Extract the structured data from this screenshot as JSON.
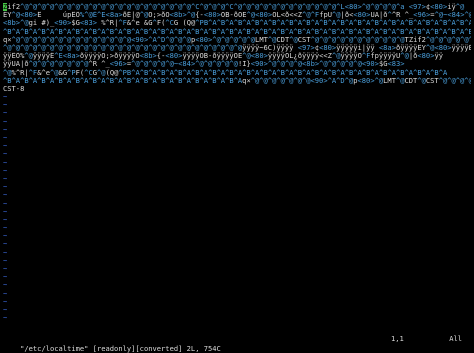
{
  "theme": {
    "background": "#000000",
    "text": "#d8d8d8",
    "control_char": "#4a9eda",
    "tilde": "#3a66d6",
    "cursor": "#46c646"
  },
  "buffer": {
    "lines": [
      [
        {
          "t": "Z",
          "c": "cursor"
        },
        {
          "t": "if2"
        },
        {
          "t": "^@^@^@^@^@^@^@^@^@^@^@^@^@^@^@^@^@^@^@^@^C^@^@^@^C^@^@^@^@^@^@^@^@^@^@^@^@^L<80>^@^@^@^@^a ",
          "c": "ctl"
        },
        {
          "t": "<97>",
          "c": "ctl"
        },
        {
          "t": "¢"
        },
        {
          "t": "<80>",
          "c": "ctl"
        },
        {
          "t": "iÿ"
        },
        {
          "t": "^@",
          "c": "ctl"
        }
      ],
      [
        {
          "t": "ÊY"
        },
        {
          "t": "^@",
          "c": "ctl"
        },
        {
          "t": "<80>",
          "c": "ctl"
        },
        {
          "t": "Ê     úpÊÖ"
        },
        {
          "t": "%",
          "c": "ctl"
        },
        {
          "t": "^@",
          "c": "ctl"
        },
        {
          "t": "Ê^E",
          "c": "ctl"
        },
        {
          "t": "<8a>",
          "c": "ctl"
        },
        {
          "t": "ðÊ|@"
        },
        {
          "t": "^@",
          "c": "ctl"
        },
        {
          "t": "O;>ðO"
        },
        {
          "t": "<8b>",
          "c": "ctl"
        },
        {
          "t": "^@",
          "c": "ctl"
        },
        {
          "t": "{-"
        },
        {
          "t": "<80>",
          "c": "ctl"
        },
        {
          "t": "ÕB-ðOE"
        },
        {
          "t": "^@",
          "c": "ctl"
        },
        {
          "t": "<80>",
          "c": "ctl"
        },
        {
          "t": "ÕL<ð<<Z"
        },
        {
          "t": "^@",
          "c": "ctl"
        },
        {
          "t": "^F",
          "c": "ctl"
        },
        {
          "t": "fpU"
        },
        {
          "t": "^@",
          "c": "ctl"
        },
        {
          "t": "|ð<"
        },
        {
          "t": "<80>",
          "c": "ctl"
        },
        {
          "t": "UA|ð"
        },
        {
          "t": "^",
          "c": "ctl"
        },
        {
          "t": "^R ^_"
        },
        {
          "t": "<96>",
          "c": "ctl"
        },
        {
          "t": "="
        },
        {
          "t": "^@",
          "c": "ctl"
        },
        {
          "t": "~<84>",
          "c": "ctl"
        },
        {
          "t": "^@",
          "c": "ctl"
        },
        {
          "t": "!I}"
        }
      ],
      [
        {
          "t": "<8b>",
          "c": "ctl"
        },
        {
          "t": "^@",
          "c": "ctl"
        },
        {
          "t": "gi #)_"
        },
        {
          "t": "<90>",
          "c": "ctl"
        },
        {
          "t": "$G"
        },
        {
          "t": "<83>",
          "c": "ctl"
        },
        {
          "t": " %^R|"
        },
        {
          "t": "^F",
          "c": "ctl"
        },
        {
          "t": "&^e &G"
        },
        {
          "t": "^",
          "c": "ctl"
        },
        {
          "t": "F("
        },
        {
          "t": "^C",
          "c": "ctl"
        },
        {
          "t": "G (Q@"
        },
        {
          "t": "^P",
          "c": "ctl"
        },
        {
          "t": "B^A^B^A^B^A^B^A^B^A^B^A^B^A^B^A^B^A^B^A^B^A^B^A^B^A^B^A^B^A^B^A",
          "c": "ctl"
        }
      ],
      [
        {
          "t": "^B^A^B^A^B^A^B^A^B^A^B^A^B^A^B^A^B^A^B^A^B^A^B^A^B^A^B^A^B^A^B^A^B^A^B^A^B^A^B^A^B^A^B^A^B^A^B^A^B^A^B^A^B^A^B^A^B^A^B^A",
          "c": "ctl"
        }
      ],
      [
        {
          "t": "q×"
        },
        {
          "t": "^@",
          "c": "ctl"
        },
        {
          "t": "^@^@^@^@^@^@^@^@^@^@^@^@^@",
          "c": "ctl"
        },
        {
          "t": "<90>",
          "c": "ctl"
        },
        {
          "t": "^A^D^@^@^@",
          "c": "ctl"
        },
        {
          "t": "p"
        },
        {
          "t": "<80>",
          "c": "ctl"
        },
        {
          "t": "^@^@^@^@^@",
          "c": "ctl"
        },
        {
          "t": "LMT"
        },
        {
          "t": "^@",
          "c": "ctl"
        },
        {
          "t": "CDT"
        },
        {
          "t": "^@",
          "c": "ctl"
        },
        {
          "t": "CST"
        },
        {
          "t": "^@^@^@^@^@^@^@^@^@^@^@",
          "c": "ctl"
        },
        {
          "t": "TZif2"
        },
        {
          "t": "^@^@^@^@^@^@^@^@^@^@^@^@^@^@^@^@^@^@^@^@^@^@^@^@",
          "c": "ctl"
        }
      ],
      [
        {
          "t": "^@^@^@^@^@^@^@^@^@^@^@^@^@^@^@^@^@^@^@^@^@^@^@^@^@^@^@^@",
          "c": "ctl"
        },
        {
          "t": "ÿÿÿÿ~6C)ÿÿÿÿ "
        },
        {
          "t": "<97>",
          "c": "ctl"
        },
        {
          "t": "¢"
        },
        {
          "t": "<80>",
          "c": "ctl"
        },
        {
          "t": "ÿÿÿÿÿi|ÿÿ "
        },
        {
          "t": "<8a>",
          "c": "ctl"
        },
        {
          "t": "ðÿÿÿÿÊY"
        },
        {
          "t": "^@",
          "c": "ctl"
        },
        {
          "t": "<80>",
          "c": "ctl"
        },
        {
          "t": "ÿÿÿÿÊ      upyy"
        }
      ],
      [
        {
          "t": "ÿÿÊÖ%"
        },
        {
          "t": "^@",
          "c": "ctl"
        },
        {
          "t": "ÿÿÿÿÊ"
        },
        {
          "t": "^E",
          "c": "ctl"
        },
        {
          "t": "<8a>",
          "c": "ctl"
        },
        {
          "t": "ðÿÿÿÿÕ;>ðÿÿÿÿÕ"
        },
        {
          "t": "<8b>",
          "c": "ctl"
        },
        {
          "t": "{-"
        },
        {
          "t": "<80>",
          "c": "ctl"
        },
        {
          "t": "ÿÿÿÿÕB-ðÿÿÿÿÕE"
        },
        {
          "t": "^@",
          "c": "ctl"
        },
        {
          "t": "<80>",
          "c": "ctl"
        },
        {
          "t": "ÿÿÿÿÕL¿ðÿÿÿÿ<<Z"
        },
        {
          "t": "^@",
          "c": "ctl"
        },
        {
          "t": "ÿÿÿÿÕ"
        },
        {
          "t": "^F",
          "c": "ctl"
        },
        {
          "t": "fpÿÿÿÿU"
        },
        {
          "t": "^@",
          "c": "ctl"
        },
        {
          "t": "|ð"
        },
        {
          "t": "<80>",
          "c": "ctl"
        },
        {
          "t": "ÿÿ"
        }
      ],
      [
        {
          "t": "ÿÿUA|ð"
        },
        {
          "t": "^@",
          "c": "ctl"
        },
        {
          "t": "^@^@^@^@^@^@",
          "c": "ctl"
        },
        {
          "t": "^R ^_"
        },
        {
          "t": "<96>",
          "c": "ctl"
        },
        {
          "t": "="
        },
        {
          "t": "^@",
          "c": "ctl"
        },
        {
          "t": "^@^@^@^@",
          "c": "ctl"
        },
        {
          "t": "~<84>",
          "c": "ctl"
        },
        {
          "t": "^@",
          "c": "ctl"
        },
        {
          "t": "^@^@^@^@",
          "c": "ctl"
        },
        {
          "t": "!I}"
        },
        {
          "t": "<90>",
          "c": "ctl"
        },
        {
          "t": "^@^@^@^@",
          "c": "ctl"
        },
        {
          "t": "<8b>",
          "c": "ctl"
        },
        {
          "t": "^@",
          "c": "ctl"
        },
        {
          "t": "^@^@^@^@",
          "c": "ctl"
        },
        {
          "t": "<90>",
          "c": "ctl"
        },
        {
          "t": "$G"
        },
        {
          "t": "<83>",
          "c": "ctl"
        }
      ],
      [
        {
          "t": "^@",
          "c": "ctl"
        },
        {
          "t": "%^R|"
        },
        {
          "t": "^F",
          "c": "ctl"
        },
        {
          "t": "&^e"
        },
        {
          "t": "^@",
          "c": "ctl"
        },
        {
          "t": "&G"
        },
        {
          "t": "^P",
          "c": "ctl"
        },
        {
          "t": "F("
        },
        {
          "t": "^C",
          "c": "ctl"
        },
        {
          "t": "G"
        },
        {
          "t": "^@",
          "c": "ctl"
        },
        {
          "t": "(Q@"
        },
        {
          "t": "^P",
          "c": "ctl"
        },
        {
          "t": "B^A^B^A^B^A^B^A^B^A^B^A^B^A^B^A^B^A^B^A^B^A^B^A^B^A^B^A^B^A^B^A^B^A^B^A^B^A",
          "c": "ctl"
        }
      ],
      [
        {
          "t": "^B^A^B^A^B^A^B^A^B^A^B^A^B^A^B^A^B^A^B^A^B^A^B^A^B^A^B^A",
          "c": "ctl"
        },
        {
          "t": "q×"
        },
        {
          "t": "^@",
          "c": "ctl"
        },
        {
          "t": "^@^@^@^@^@^@",
          "c": "ctl"
        },
        {
          "t": "<90>",
          "c": "ctl"
        },
        {
          "t": "^A^D^@",
          "c": "ctl"
        },
        {
          "t": "p"
        },
        {
          "t": "<80>",
          "c": "ctl"
        },
        {
          "t": "^@",
          "c": "ctl"
        },
        {
          "t": "LMT"
        },
        {
          "t": "^@",
          "c": "ctl"
        },
        {
          "t": "CDT"
        },
        {
          "t": "^@",
          "c": "ctl"
        },
        {
          "t": "CST"
        },
        {
          "t": "^@^@^@^@^@^@^@^@^@^@^@^@^@",
          "c": "ctl"
        }
      ],
      [
        {
          "t": "CST-8"
        }
      ]
    ],
    "tilde_rows": 28,
    "tilde_char": "~"
  },
  "statusline": {
    "file": "\"/etc/localtime\" [readonly][converted] 2L, 754C",
    "position": "1,1",
    "scroll": "All"
  }
}
